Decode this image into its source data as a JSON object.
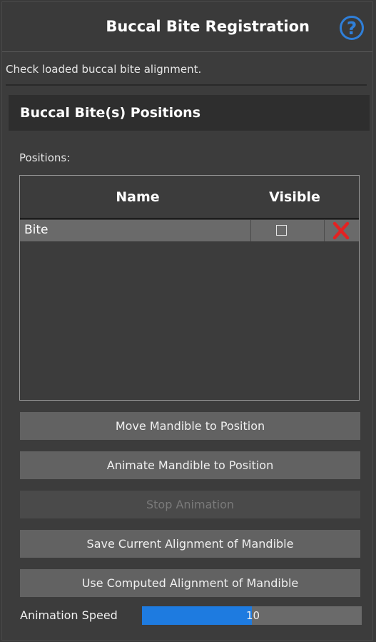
{
  "header": {
    "title": "Buccal Bite Registration",
    "help_icon": "help-icon",
    "help_glyph": "?",
    "accent_color": "#2f7fd9"
  },
  "description": "Check loaded buccal bite alignment.",
  "section": {
    "title": "Buccal Bite(s) Positions",
    "positions_label": "Positions:",
    "table": {
      "columns": [
        "Name",
        "Visible"
      ],
      "rows": [
        {
          "name": "Bite",
          "visible": false
        }
      ]
    },
    "buttons": {
      "move": "Move Mandible to Position",
      "animate": "Animate Mandible to Position",
      "stop": "Stop Animation",
      "save": "Save Current Alignment of Mandible",
      "use_computed": "Use Computed Alignment of Mandible"
    },
    "animation_speed": {
      "label": "Animation Speed",
      "value": "10",
      "fill_fraction": 0.5,
      "fill_color": "#1e7be0"
    }
  }
}
